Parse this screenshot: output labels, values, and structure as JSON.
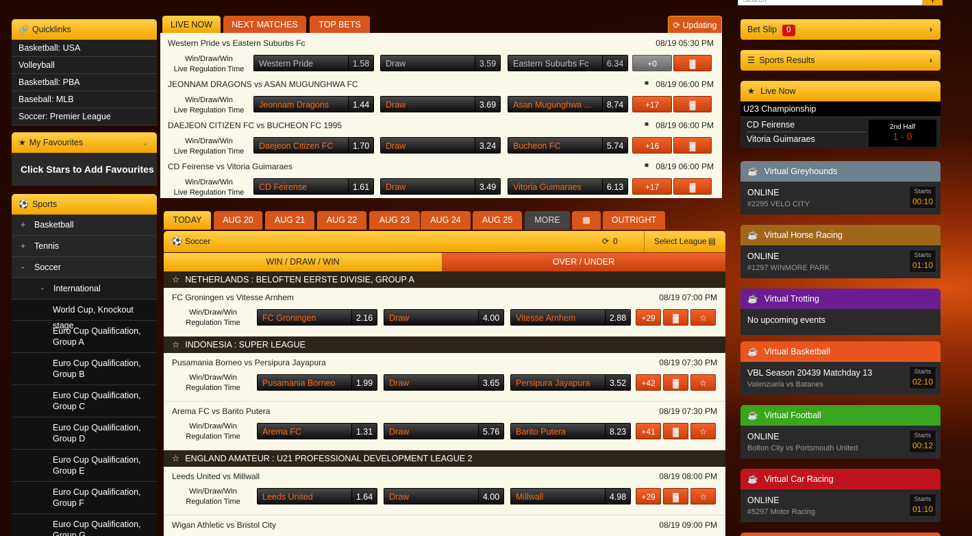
{
  "top": {
    "search_placeholder": "Search",
    "search_icon": "search-icon"
  },
  "left": {
    "quicklinks_title": "Quicklinks",
    "quicklinks": [
      "Basketball: USA",
      "Volleyball",
      "Basketball: PBA",
      "Baseball: MLB",
      "Soccer: Premier League"
    ],
    "favourites_title": "My Favourites",
    "favourites_hint": "Click Stars to Add Favourites",
    "sports_title": "Sports",
    "sports": [
      {
        "pm": "+",
        "label": "Basketball"
      },
      {
        "pm": "+",
        "label": "Tennis"
      },
      {
        "pm": "-",
        "label": "Soccer"
      }
    ],
    "international": {
      "pm": "-",
      "label": "International"
    },
    "competitions": [
      "World Cup, Knockout stage",
      "Euro Cup Qualification, Group A",
      "Euro Cup Qualification, Group B",
      "Euro Cup Qualification, Group C",
      "Euro Cup Qualification, Group D",
      "Euro Cup Qualification, Group E",
      "Euro Cup Qualification, Group F",
      "Euro Cup Qualification, Group G"
    ]
  },
  "live": {
    "tabs": [
      "LIVE NOW",
      "NEXT MATCHES",
      "TOP BETS"
    ],
    "updating": "Updating",
    "label_l1": "Win/Draw/Win",
    "label_l2": "Live Regulation Time",
    "matches": [
      {
        "title": "Western Pride vs Eastern Suburbs Fc",
        "time": "08/19 05:30 PM",
        "home": "Western Pride",
        "home_odd": "1.58",
        "draw": "Draw",
        "draw_odd": "3.59",
        "away": "Eastern Suburbs Fc",
        "away_odd": "6.34",
        "more": "+0"
      },
      {
        "title": "JEONNAM DRAGONS vs ASAN MUGUNGHWA FC",
        "time": "08/19 06:00 PM",
        "home": "Jeonnam Dragons",
        "home_odd": "1.44",
        "draw": "Draw",
        "draw_odd": "3.69",
        "away": "Asan Mugunghwa ...",
        "away_odd": "8.74",
        "more": "+17"
      },
      {
        "title": "DAEJEON CITIZEN FC vs BUCHEON FC 1995",
        "time": "08/19 06:00 PM",
        "home": "Daejeon Citizen FC",
        "home_odd": "1.70",
        "draw": "Draw",
        "draw_odd": "3.24",
        "away": "Bucheon FC",
        "away_odd": "5.74",
        "more": "+16"
      },
      {
        "title": "CD Feirense vs Vitoria Guimaraes",
        "time": "08/19 06:00 PM",
        "home": "CD Feirense",
        "home_odd": "1.61",
        "draw": "Draw",
        "draw_odd": "3.49",
        "away": "Vitoria Guimaraes",
        "away_odd": "6.13",
        "more": "+17"
      }
    ]
  },
  "dates": {
    "tabs": [
      "TODAY",
      "AUG 20",
      "AUG 21",
      "AUG 22",
      "AUG 23",
      "AUG 24",
      "AUG 25",
      "MORE"
    ],
    "outright": "OUTRIGHT"
  },
  "soccer": {
    "title": "Soccer",
    "refresh_count": "0",
    "select_league": "Select League",
    "market_tabs": [
      "WIN / DRAW / WIN",
      "OVER / UNDER"
    ],
    "label_l1": "Win/Draw/Win",
    "label_l2": "Regulation Time",
    "leagues": [
      {
        "name": "NETHERLANDS : BELOFTEN EERSTE DIVISIE, GROUP A"
      },
      {
        "name": "INDONESIA : SUPER LEAGUE"
      },
      {
        "name": "ENGLAND AMATEUR : U21 PROFESSIONAL DEVELOPMENT LEAGUE 2"
      }
    ],
    "matches": [
      {
        "title": "FC Groningen vs Vitesse Arnhem",
        "time": "08/19 07:00 PM",
        "home": "FC Groningen",
        "home_odd": "2.16",
        "draw": "Draw",
        "draw_odd": "4.00",
        "away": "Vitesse Arnhem",
        "away_odd": "2.88",
        "more": "+29"
      },
      {
        "title": "Pusamania Borneo vs Persipura Jayapura",
        "time": "08/19 07:30 PM",
        "home": "Pusamania Borneo",
        "home_odd": "1.99",
        "draw": "Draw",
        "draw_odd": "3.65",
        "away": "Persipura Jayapura",
        "away_odd": "3.52",
        "more": "+42"
      },
      {
        "title": "Arema FC vs Barito Putera",
        "time": "08/19 07:30 PM",
        "home": "Arema FC",
        "home_odd": "1.31",
        "draw": "Draw",
        "draw_odd": "5.76",
        "away": "Barito Putera",
        "away_odd": "8.23",
        "more": "+41"
      },
      {
        "title": "Leeds United vs Millwall",
        "time": "08/19 08:00 PM",
        "home": "Leeds United",
        "home_odd": "1.64",
        "draw": "Draw",
        "draw_odd": "4.00",
        "away": "Millwall",
        "away_odd": "4.98",
        "more": "+29"
      },
      {
        "title": "Wigan Athletic vs Bristol City",
        "time": "08/19 09:00 PM"
      }
    ]
  },
  "right": {
    "betslip": {
      "label": "Bet Slip",
      "count": "0"
    },
    "results": "Sports Results",
    "livenow": {
      "title": "Live Now",
      "competition": "U23 Championship",
      "home": "CD Feirense",
      "away": "Vitoria Guimaraes",
      "period": "2nd Half",
      "score": "1 - 0"
    },
    "starts_label": "Starts",
    "virtuals": [
      {
        "title": "Virtual Greyhounds",
        "status": "ONLINE",
        "sub": "#2295 VELO CITY",
        "time": "00:10",
        "color": "#6f7f8c"
      },
      {
        "title": "Virtual Horse Racing",
        "status": "ONLINE",
        "sub": "#1297 WINMORE PARK",
        "time": "01:10",
        "color": "#a0671c"
      },
      {
        "title": "Virtual Trotting",
        "status": "No upcoming events",
        "color": "#6a1e92"
      },
      {
        "title": "Virtual Basketball",
        "status": "VBL Season 20439 Matchday 13",
        "sub": "Valenzuela vs Batanes",
        "time": "02:10",
        "color": "#e9551f"
      },
      {
        "title": "Virtual Football",
        "status": "ONLINE",
        "sub": "Bolton City vs Portsmouth United",
        "time": "00:12",
        "color": "#3aa51f"
      },
      {
        "title": "Virtual Car Racing",
        "status": "ONLINE",
        "sub": "#5297 Motor Racing",
        "time": "01:10",
        "color": "#c0151f"
      }
    ]
  }
}
